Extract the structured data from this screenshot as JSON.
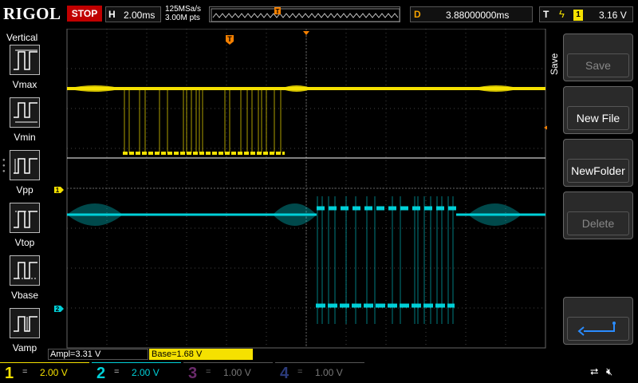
{
  "brand": "RIGOL",
  "run_state": "STOP",
  "horizontal": {
    "label": "H",
    "scale": "2.00ms"
  },
  "acquisition": {
    "sample_rate": "125MSa/s",
    "memory_depth": "3.00M pts"
  },
  "delay": {
    "label": "D",
    "value": "3.88000000ms"
  },
  "trigger": {
    "label": "T",
    "source_channel": "1",
    "level": "3.16 V",
    "edge_icon": "rising-edge-icon"
  },
  "left_panel": {
    "title": "Vertical",
    "items": [
      "Vmax",
      "Vmin",
      "Vpp",
      "Vtop",
      "Vbase",
      "Vamp"
    ]
  },
  "save_menu": {
    "title": "Save",
    "buttons": [
      {
        "label": "Save",
        "enabled": false
      },
      {
        "label": "New File",
        "enabled": true
      },
      {
        "label": "NewFolder",
        "enabled": true
      },
      {
        "label": "Delete",
        "enabled": false
      }
    ],
    "back_icon": "return-arrow-icon"
  },
  "markers": {
    "trigger_marker": "T",
    "ch1_marker": "1",
    "ch2_marker": "2"
  },
  "measurements": {
    "ampl": "Ampl=3.31 V",
    "base": "Base=1.68 V"
  },
  "channels": [
    {
      "num": "1",
      "coupling": "=",
      "scale": "2.00 V",
      "color": "#f5e100",
      "active": true
    },
    {
      "num": "2",
      "coupling": "=",
      "scale": "2.00 V",
      "color": "#00d0d8",
      "active": true
    },
    {
      "num": "3",
      "coupling": "=",
      "scale": "1.00 V",
      "color": "#d040d0",
      "active": false
    },
    {
      "num": "4",
      "coupling": "=",
      "scale": "1.00 V",
      "color": "#3060e0",
      "active": false
    }
  ],
  "status_icons": [
    "usb-icon",
    "speaker-mute-icon"
  ],
  "colors": {
    "ch1": "#f5e100",
    "ch2": "#00d0d8",
    "trigger": "#f58000",
    "grid": "#555555"
  }
}
